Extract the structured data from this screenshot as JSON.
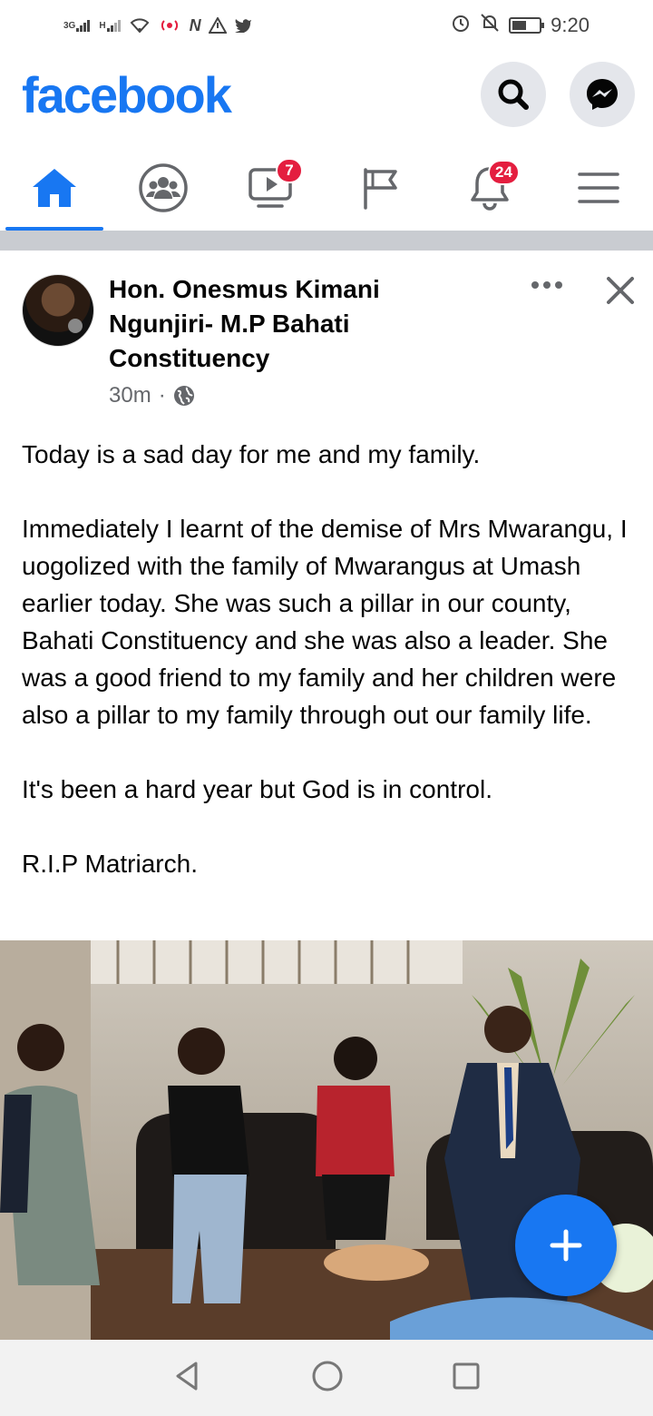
{
  "status_bar": {
    "network_1": "3G",
    "network_2": "H",
    "time": "9:20"
  },
  "header": {
    "logo": "facebook",
    "search_icon": "search-icon",
    "messenger_icon": "messenger-icon"
  },
  "nav": {
    "tabs": [
      {
        "name": "home",
        "icon": "home-icon",
        "active": true
      },
      {
        "name": "groups",
        "icon": "groups-icon"
      },
      {
        "name": "watch",
        "icon": "video-icon",
        "badge": "7"
      },
      {
        "name": "pages",
        "icon": "flag-icon"
      },
      {
        "name": "notifications",
        "icon": "bell-icon",
        "badge": "24"
      },
      {
        "name": "menu",
        "icon": "hamburger-icon"
      }
    ]
  },
  "post": {
    "author": "Hon. Onesmus Kimani Ngunjiri- M.P Bahati Constituency",
    "time": "30m",
    "separator": "·",
    "paragraphs": [
      "Today is a sad day for me and my family.",
      "Immediately I learnt of the demise of Mrs Mwarangu, I uogolized with the family of Mwarangus at Umash earlier today. She was such a pillar in our county, Bahati Constituency and she was also a leader. She was a good friend to my family and her children were also a pillar to my family through out our family life.",
      "It's been a hard year but God is in control.",
      "R.I.P Matriarch."
    ]
  },
  "colors": {
    "brand": "#1877f2",
    "badge": "#e41e3f",
    "divider": "#c9ccd1",
    "secondary_text": "#65676b"
  }
}
